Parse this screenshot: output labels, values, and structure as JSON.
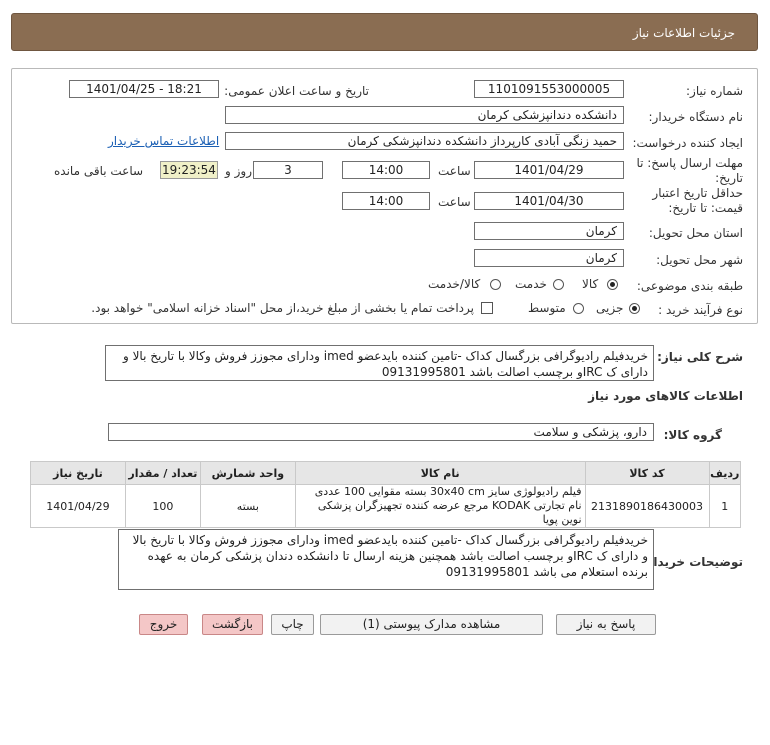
{
  "header": {
    "title": "جزئیات اطلاعات نیاز"
  },
  "form": {
    "need_number_label": "شماره نیاز:",
    "need_number": "1101091553000005",
    "announce_label": "تاریخ و ساعت اعلان عمومی:",
    "announce_value": "1401/04/25 - 18:21",
    "buyer_org_label": "نام دستگاه خریدار:",
    "buyer_org": "دانشکده دندانپزشکی کرمان",
    "creator_label": "ایجاد کننده درخواست:",
    "creator": "حمید زنگی آبادی کارپرداز دانشکده دندانپزشکی کرمان",
    "contact_link": "اطلاعات تماس خریدار",
    "deadline_label": "مهلت ارسال پاسخ: تا تاریخ:",
    "deadline_date": "1401/04/29",
    "time_label": "ساعت",
    "deadline_time": "14:00",
    "days_value": "3",
    "days_label": "روز و",
    "remaining_time": "19:23:54",
    "remaining_label": "ساعت باقی مانده",
    "validity_label": "حداقل تاریخ اعتبار قیمت: تا تاریخ:",
    "validity_date": "1401/04/30",
    "validity_time": "14:00",
    "province_label": "استان محل تحویل:",
    "province": "کرمان",
    "city_label": "شهر محل تحویل:",
    "city": "کرمان",
    "category_label": "طبقه بندی موضوعی:",
    "cat_goods": "کالا",
    "cat_service": "خدمت",
    "cat_both": "کالا/خدمت",
    "process_label": "نوع فرآیند خرید :",
    "proc_partial": "جزیی",
    "proc_medium": "متوسط",
    "payment_note": "پرداخت تمام یا بخشی از مبلغ خرید،از محل \"اسناد خزانه اسلامی\" خواهد بود."
  },
  "summary": {
    "label": "شرح کلی نیاز:",
    "text": "خریدفیلم رادیوگرافی بزرگسال کداک -تامین کننده بایدعضو imed ودارای مجوزز فروش وکالا با تاریخ بالا و دارای ک IRCو برچسب اصالت باشد 09131995801"
  },
  "items_section": {
    "title": "اطلاعات کالاهای مورد نیاز",
    "group_label": "گروه کالا:",
    "group_value": "دارو، پزشکی و سلامت"
  },
  "table": {
    "headers": [
      "ردیف",
      "کد کالا",
      "نام کالا",
      "واحد شمارش",
      "تعداد / مقدار",
      "تاریخ نیاز"
    ],
    "rows": [
      {
        "row": "1",
        "code": "2131890186430003",
        "name": "فیلم رادیولوژی سایز 30x40 cm بسته مقوایی 100 عددی نام تجارتی KODAK مرجع عرضه کننده تجهیزگران پزشکی نوین پویا",
        "unit": "بسته",
        "qty": "100",
        "date": "1401/04/29"
      }
    ]
  },
  "buyer_desc": {
    "label": "توضیحات خریدار:",
    "text": "خریدفیلم رادیوگرافی بزرگسال کداک -تامین کننده بایدعضو imed ودارای مجوزز فروش وکالا با تاریخ بالا و دارای ک IRCو برچسب اصالت باشد همچنین هزینه ارسال تا دانشکده دندان پزشکی کرمان به عهده برنده استعلام می باشد 09131995801"
  },
  "buttons": {
    "reply": "پاسخ به نیاز",
    "attachments": "مشاهده مدارک پیوستی (1)",
    "print": "چاپ",
    "back": "بازگشت",
    "exit": "خروج"
  }
}
